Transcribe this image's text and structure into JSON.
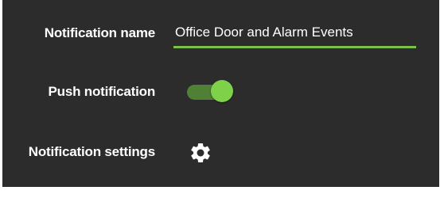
{
  "form": {
    "notification_name": {
      "label": "Notification name",
      "value": "Office Door and Alarm Events"
    },
    "push_notification": {
      "label": "Push notification",
      "enabled": true
    },
    "notification_settings": {
      "label": "Notification settings",
      "icon": "gear-icon"
    }
  },
  "colors": {
    "background": "#2c2c2c",
    "accent": "#7fd14a",
    "accent_track": "#4f8035",
    "underline": "#7bc04a",
    "text": "#ffffff"
  }
}
